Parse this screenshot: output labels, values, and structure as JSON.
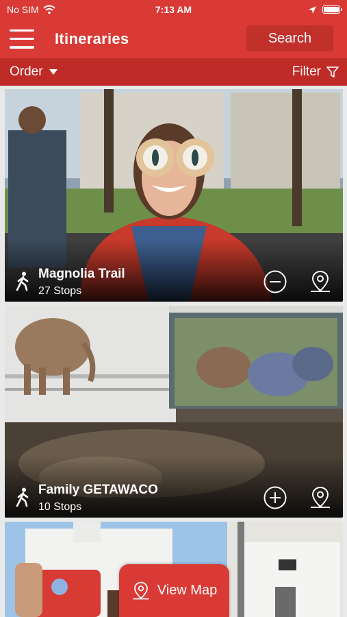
{
  "status_bar": {
    "carrier": "No SIM",
    "time": "7:13 AM"
  },
  "header": {
    "title": "Itineraries",
    "search_label": "Search"
  },
  "toolbar": {
    "order_label": "Order",
    "filter_label": "Filter"
  },
  "itineraries": [
    {
      "title": "Magnolia Trail",
      "stops": "27 Stops",
      "action": "remove"
    },
    {
      "title": "Family GETAWACO",
      "stops": "10 Stops",
      "action": "add"
    },
    {
      "title": "",
      "stops": "",
      "action": ""
    }
  ],
  "view_map": {
    "label": "View Map"
  },
  "colors": {
    "brand_red": "#d93a35",
    "toolbar_red": "#bf2b27",
    "search_button": "#c2302c",
    "background": "#e9e9e9"
  },
  "icons": [
    "menu-icon",
    "wifi-icon",
    "location-arrow-icon",
    "battery-icon",
    "chevron-down-icon",
    "filter-icon",
    "walking-icon",
    "minus-circle-icon",
    "plus-circle-icon",
    "map-pin-icon"
  ]
}
